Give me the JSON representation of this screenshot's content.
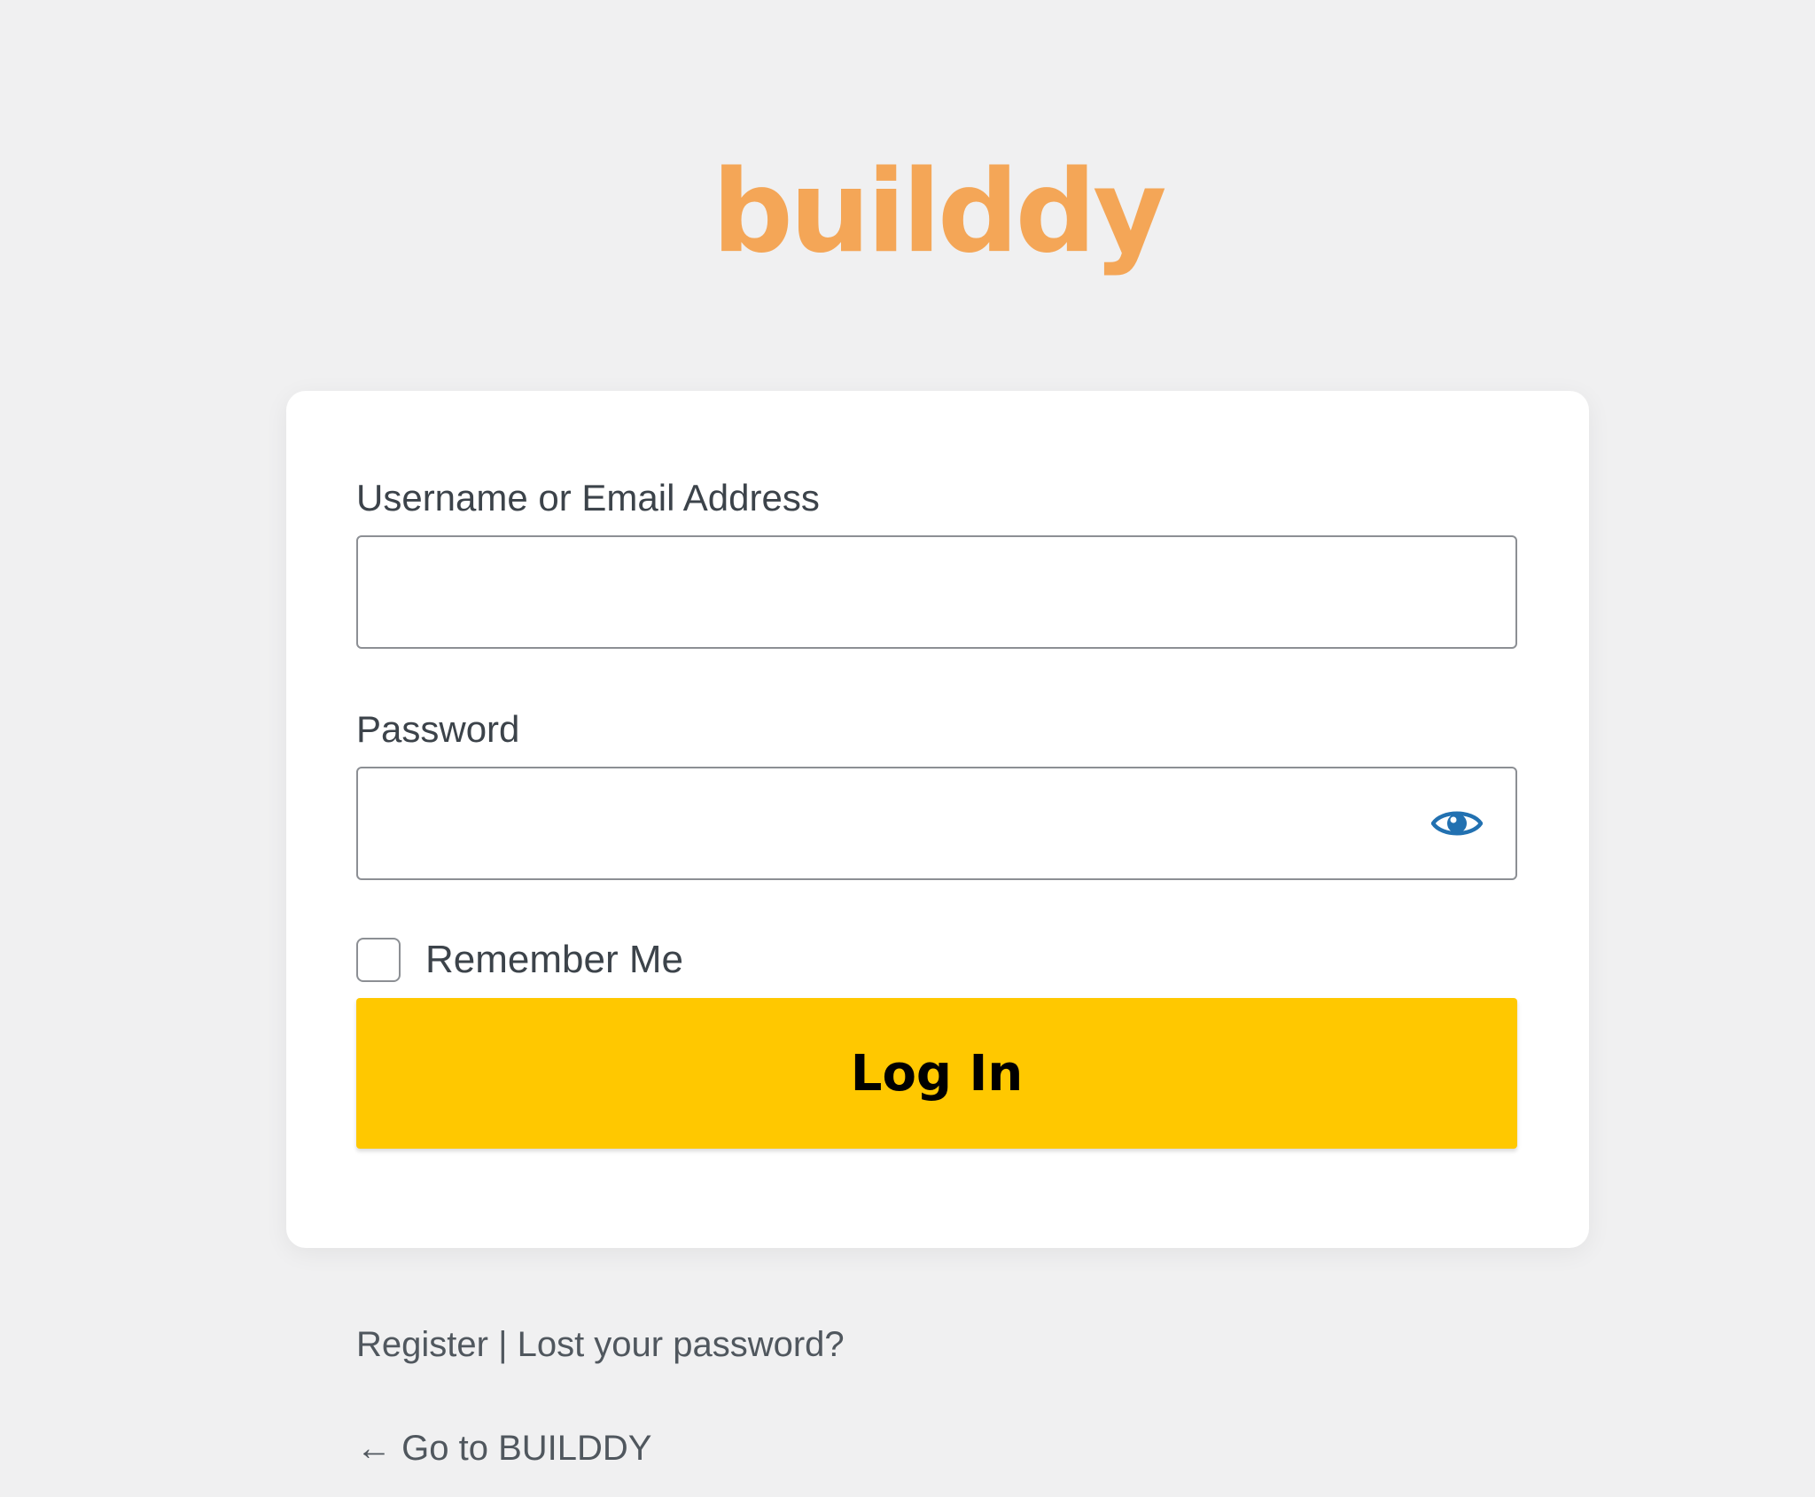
{
  "logo": {
    "text": "builddy",
    "color": "#f4a657"
  },
  "form": {
    "username_label": "Username or Email Address",
    "username_value": "",
    "password_label": "Password",
    "password_value": "",
    "show_password_icon": "eye-icon",
    "remember_label": "Remember Me",
    "remember_checked": false,
    "submit_label": "Log In",
    "submit_color": "#ffc800"
  },
  "links": {
    "register": "Register",
    "separator": " | ",
    "lost_password": "Lost your password?",
    "back_arrow": "←",
    "back_label": "Go to BUILDDY"
  },
  "colors": {
    "background": "#f0f0f1",
    "card": "#ffffff",
    "eye_icon": "#2271b1"
  }
}
